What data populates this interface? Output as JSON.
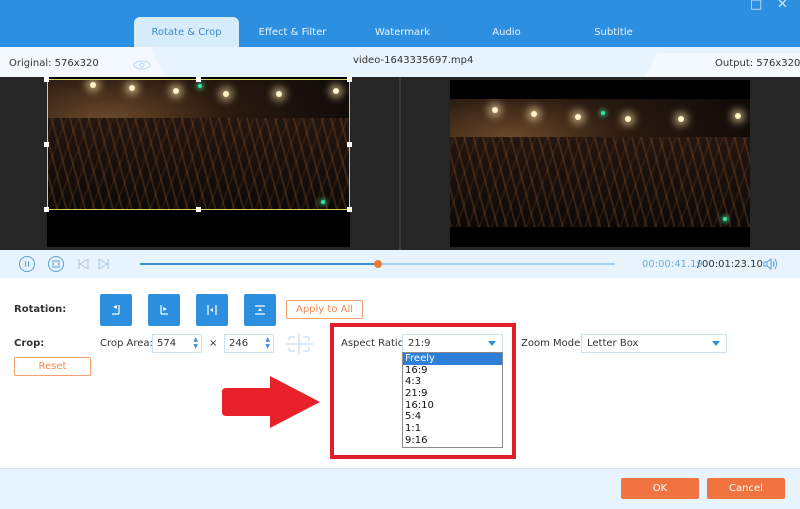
{
  "window": {
    "maximize_icon": "□",
    "close_icon": "✕"
  },
  "tabs": [
    {
      "label": "Rotate & Crop",
      "active": true
    },
    {
      "label": "Effect & Filter",
      "active": false
    },
    {
      "label": "Watermark",
      "active": false
    },
    {
      "label": "Audio",
      "active": false
    },
    {
      "label": "Subtitle",
      "active": false
    }
  ],
  "infobar": {
    "original_label": "Original: 576x320",
    "filename": "video-1643335697.mp4",
    "output_label": "Output: 576x320"
  },
  "player": {
    "current_time": "00:00:41.19",
    "separator": "/",
    "total_time": "00:01:23.10",
    "progress_fraction": 0.5
  },
  "rotation": {
    "label": "Rotation:",
    "buttons": [
      {
        "name": "rotate-left",
        "glyph": "↶"
      },
      {
        "name": "rotate-right",
        "glyph": "↷"
      },
      {
        "name": "flip-horizontal",
        "glyph": "⇹"
      },
      {
        "name": "flip-vertical",
        "glyph": "⇵"
      }
    ],
    "apply_all_label": "Apply to All"
  },
  "crop": {
    "label": "Crop:",
    "area_label": "Crop Area:",
    "width": "574",
    "times": "×",
    "height": "246",
    "reset_label": "Reset"
  },
  "aspect_ratio": {
    "label": "Aspect Ratio:",
    "value": "21:9",
    "options": [
      "Freely",
      "16:9",
      "4:3",
      "21:9",
      "16:10",
      "5:4",
      "1:1",
      "9:16"
    ],
    "highlighted_index": 0
  },
  "zoom_mode": {
    "label": "Zoom Mode:",
    "value": "Letter Box"
  },
  "footer": {
    "ok_label": "OK",
    "cancel_label": "Cancel"
  },
  "colors": {
    "accent": "#2d8fe0",
    "action": "#f07340",
    "annotation": "#e01f26"
  }
}
